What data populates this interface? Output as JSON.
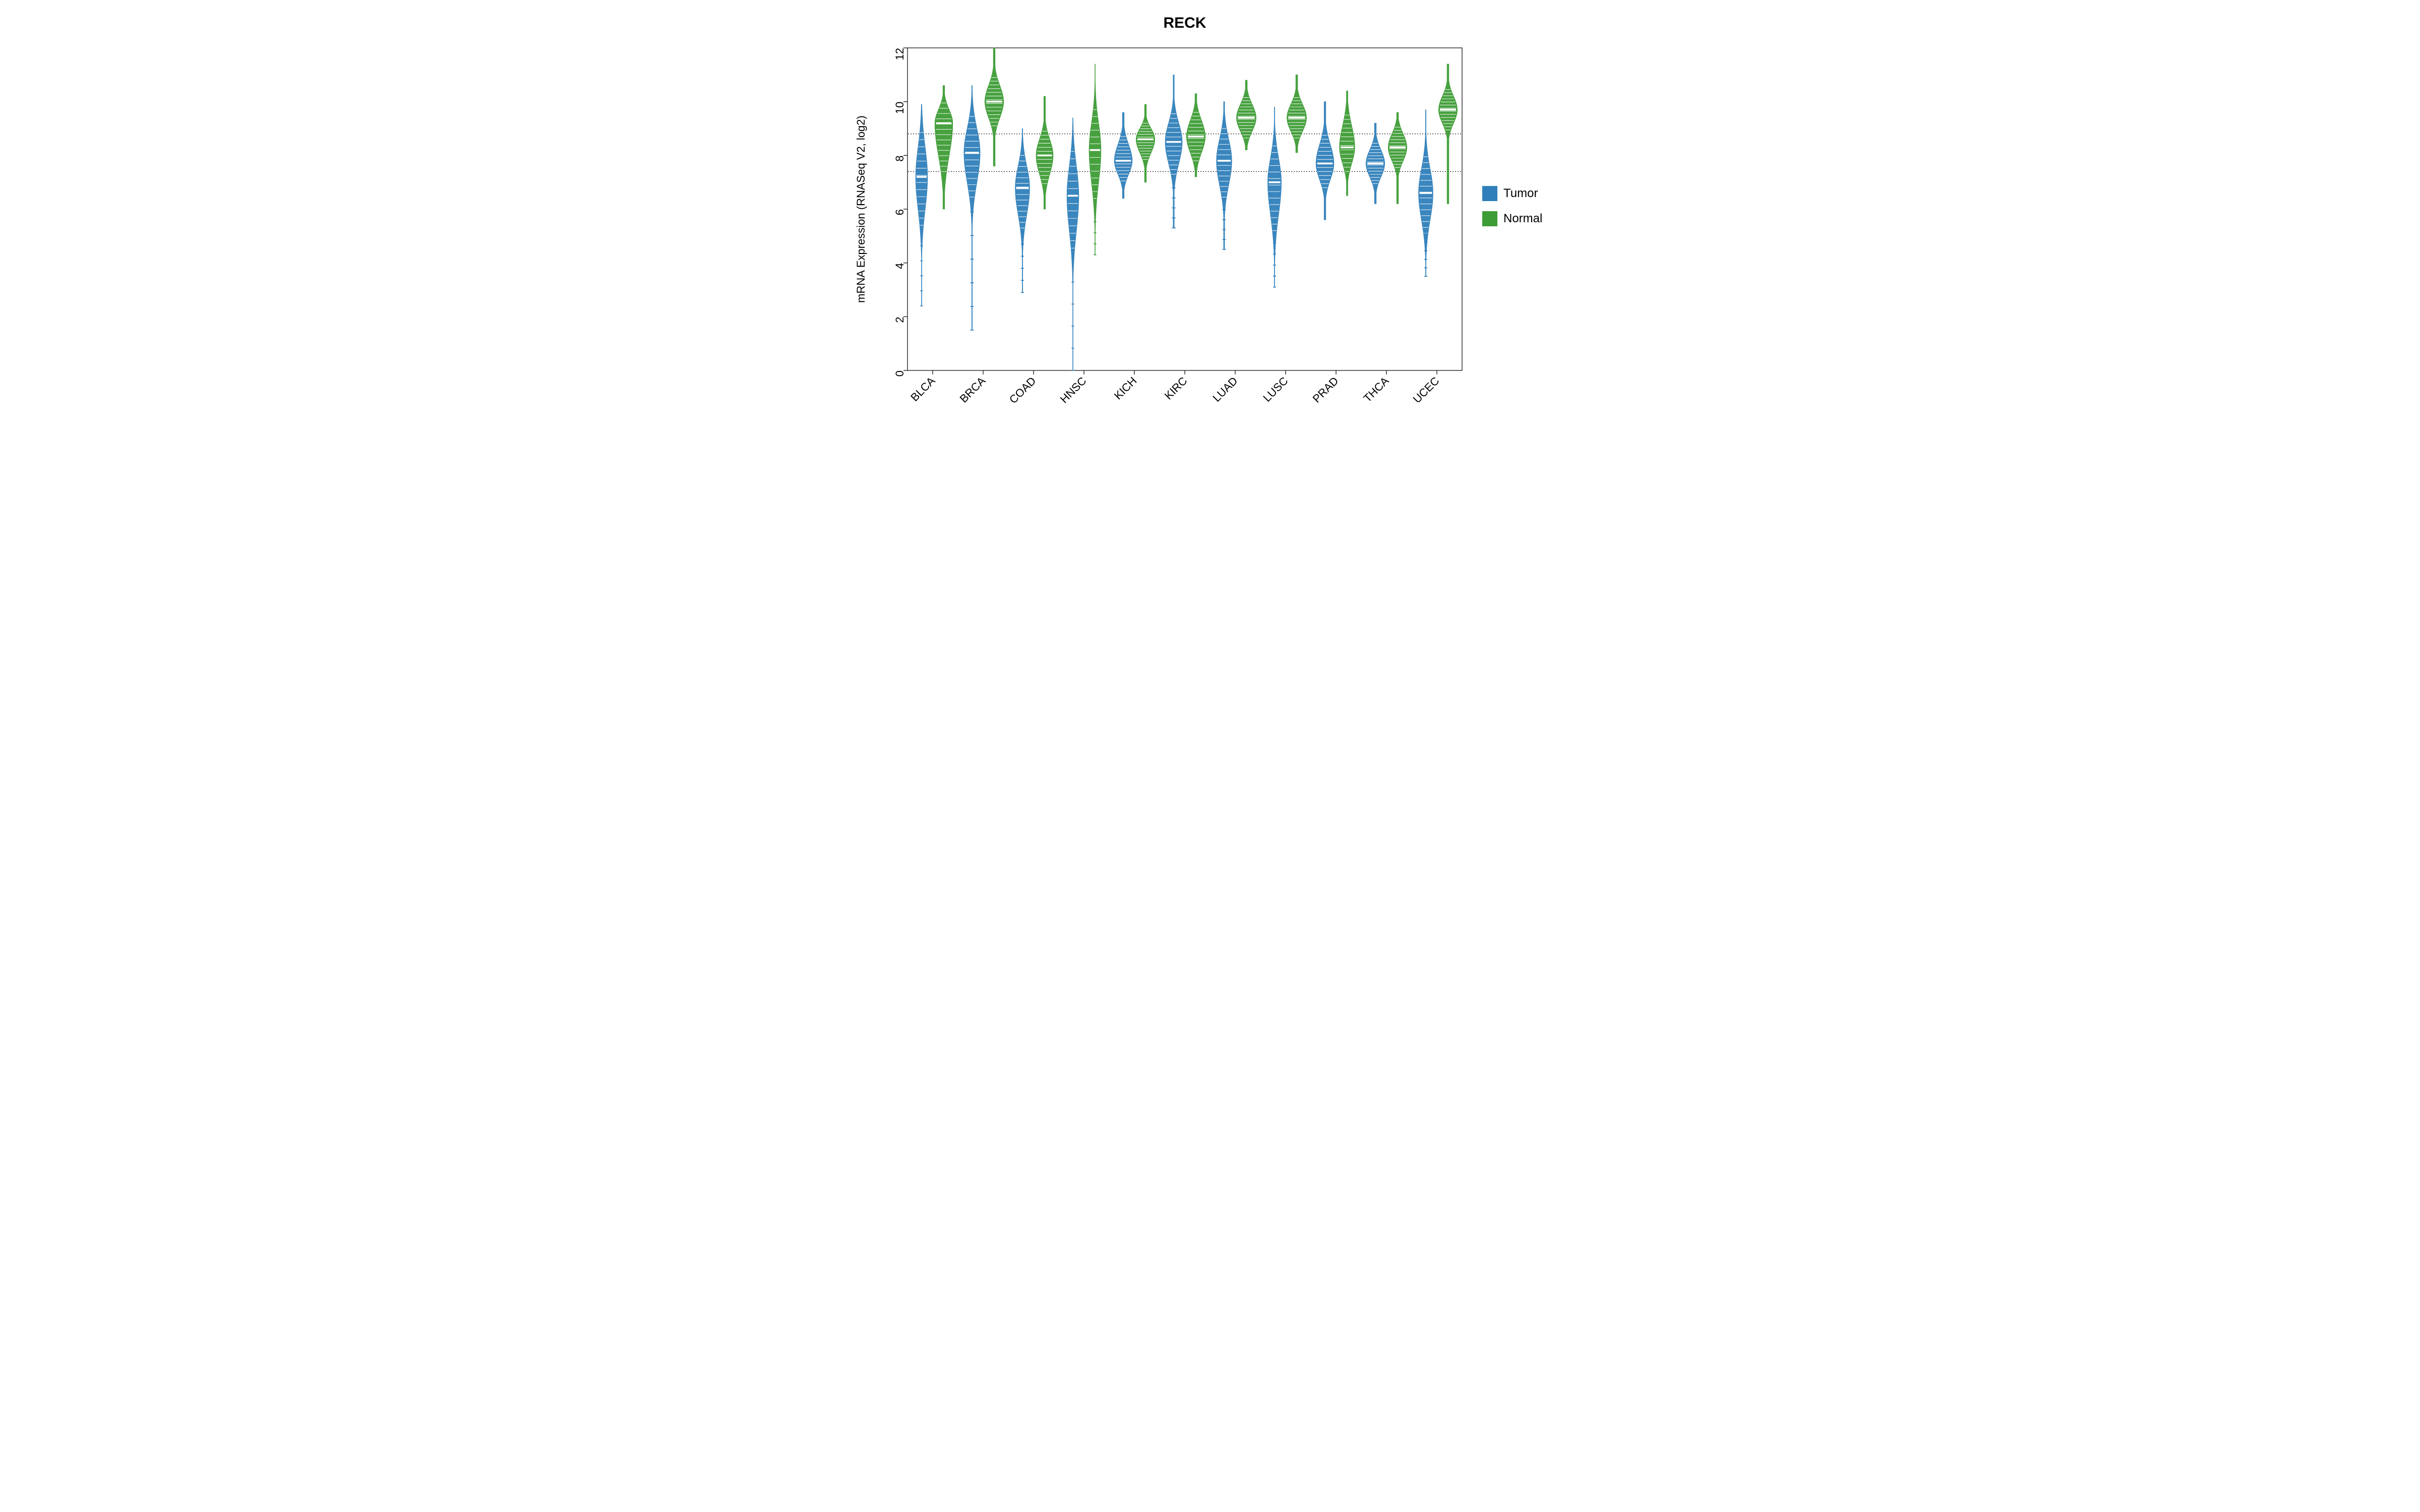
{
  "chart_data": {
    "type": "violin",
    "title": "RECK",
    "ylabel": "mRNA Expression (RNASeq V2, log2)",
    "xlabel": "",
    "ylim": [
      0,
      12
    ],
    "yticks": [
      0,
      2,
      4,
      6,
      8,
      10,
      12
    ],
    "categories": [
      "BLCA",
      "BRCA",
      "COAD",
      "HNSC",
      "KICH",
      "KIRC",
      "LUAD",
      "LUSC",
      "PRAD",
      "THCA",
      "UCEC"
    ],
    "series": [
      {
        "name": "Tumor",
        "color": "#2f7fba"
      },
      {
        "name": "Normal",
        "color": "#3d9c35"
      }
    ],
    "reference_lines": [
      7.4,
      8.8
    ],
    "violins": {
      "BLCA": {
        "Tumor": {
          "median": 7.2,
          "min": 2.4,
          "max": 9.9,
          "q1": 6.0,
          "q3": 8.3,
          "mode_width": 0.7,
          "tail": "long"
        },
        "Normal": {
          "median": 9.2,
          "min": 6.0,
          "max": 10.6,
          "q1": 8.0,
          "q3": 9.7,
          "mode_width": 1.05,
          "tail": "short"
        }
      },
      "BRCA": {
        "Tumor": {
          "median": 8.1,
          "min": 1.5,
          "max": 10.6,
          "q1": 7.0,
          "q3": 9.0,
          "mode_width": 0.95,
          "tail": "long"
        },
        "Normal": {
          "median": 10.0,
          "min": 7.6,
          "max": 12.0,
          "q1": 9.4,
          "q3": 10.6,
          "mode_width": 1.1,
          "tail": "short"
        }
      },
      "COAD": {
        "Tumor": {
          "median": 6.8,
          "min": 2.9,
          "max": 9.0,
          "q1": 5.8,
          "q3": 7.6,
          "mode_width": 0.85,
          "tail": "long"
        },
        "Normal": {
          "median": 8.0,
          "min": 6.0,
          "max": 10.2,
          "q1": 7.3,
          "q3": 8.6,
          "mode_width": 1.0,
          "tail": "short"
        }
      },
      "HNSC": {
        "Tumor": {
          "median": 6.5,
          "min": 0.0,
          "max": 9.4,
          "q1": 5.2,
          "q3": 7.6,
          "mode_width": 0.7,
          "tail": "long"
        },
        "Normal": {
          "median": 8.2,
          "min": 4.3,
          "max": 11.4,
          "q1": 7.0,
          "q3": 9.2,
          "mode_width": 0.7,
          "tail": "long"
        }
      },
      "KICH": {
        "Tumor": {
          "median": 7.8,
          "min": 6.4,
          "max": 9.6,
          "q1": 7.3,
          "q3": 8.4,
          "mode_width": 1.05,
          "tail": "short"
        },
        "Normal": {
          "median": 8.6,
          "min": 7.0,
          "max": 9.9,
          "q1": 8.1,
          "q3": 9.0,
          "mode_width": 1.1,
          "tail": "short"
        }
      },
      "KIRC": {
        "Tumor": {
          "median": 8.5,
          "min": 5.3,
          "max": 11.0,
          "q1": 7.7,
          "q3": 9.2,
          "mode_width": 1.0,
          "tail": "mid"
        },
        "Normal": {
          "median": 8.7,
          "min": 7.2,
          "max": 10.3,
          "q1": 8.1,
          "q3": 9.3,
          "mode_width": 1.1,
          "tail": "short"
        }
      },
      "LUAD": {
        "Tumor": {
          "median": 7.8,
          "min": 4.5,
          "max": 10.0,
          "q1": 6.9,
          "q3": 8.6,
          "mode_width": 0.9,
          "tail": "mid"
        },
        "Normal": {
          "median": 9.4,
          "min": 8.2,
          "max": 10.8,
          "q1": 8.9,
          "q3": 9.9,
          "mode_width": 1.15,
          "tail": "short"
        }
      },
      "LUSC": {
        "Tumor": {
          "median": 7.0,
          "min": 3.1,
          "max": 9.8,
          "q1": 5.8,
          "q3": 7.9,
          "mode_width": 0.8,
          "tail": "long"
        },
        "Normal": {
          "median": 9.4,
          "min": 8.1,
          "max": 11.0,
          "q1": 8.9,
          "q3": 9.9,
          "mode_width": 1.15,
          "tail": "short"
        }
      },
      "PRAD": {
        "Tumor": {
          "median": 7.7,
          "min": 5.6,
          "max": 10.0,
          "q1": 7.1,
          "q3": 8.4,
          "mode_width": 1.05,
          "tail": "short"
        },
        "Normal": {
          "median": 8.3,
          "min": 6.5,
          "max": 10.4,
          "q1": 7.7,
          "q3": 9.1,
          "mode_width": 0.9,
          "tail": "short"
        }
      },
      "THCA": {
        "Tumor": {
          "median": 7.7,
          "min": 6.2,
          "max": 9.2,
          "q1": 7.2,
          "q3": 8.2,
          "mode_width": 1.1,
          "tail": "short"
        },
        "Normal": {
          "median": 8.3,
          "min": 6.2,
          "max": 9.6,
          "q1": 7.8,
          "q3": 8.8,
          "mode_width": 1.1,
          "tail": "short"
        }
      },
      "UCEC": {
        "Tumor": {
          "median": 6.6,
          "min": 3.5,
          "max": 9.7,
          "q1": 5.6,
          "q3": 7.5,
          "mode_width": 0.85,
          "tail": "long"
        },
        "Normal": {
          "median": 9.7,
          "min": 6.2,
          "max": 11.4,
          "q1": 9.2,
          "q3": 10.2,
          "mode_width": 1.1,
          "tail": "short"
        }
      }
    }
  },
  "legend": {
    "items": [
      {
        "label": "Tumor",
        "color": "#2f7fba"
      },
      {
        "label": "Normal",
        "color": "#3d9c35"
      }
    ]
  }
}
